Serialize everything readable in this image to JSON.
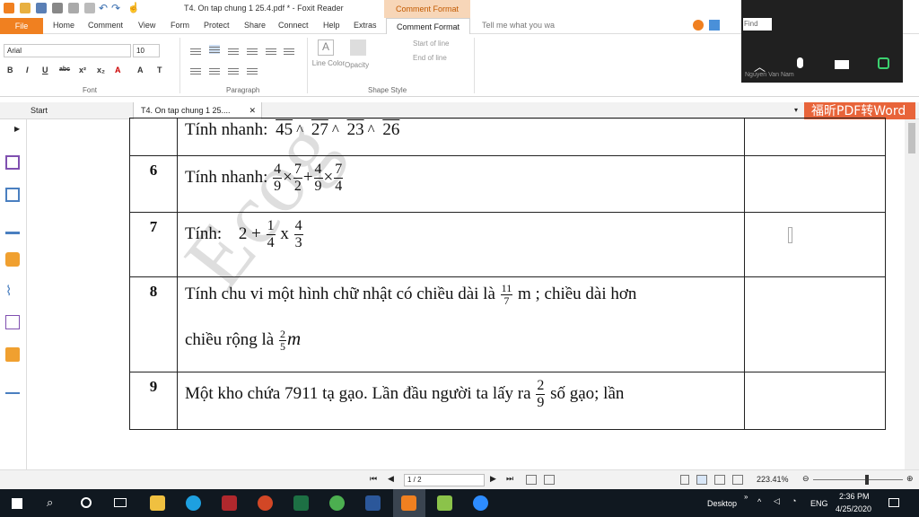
{
  "window": {
    "title": "T4. On tap chung 1 25.4.pdf * - Foxit Reader",
    "contextual_tab": "Comment Format"
  },
  "ribbon_tabs": [
    "File",
    "Home",
    "Comment",
    "View",
    "Form",
    "Protect",
    "Share",
    "Connect",
    "Help",
    "Extras",
    "Comment Format"
  ],
  "tell_me_placeholder": "Tell me what you wa",
  "ribbon": {
    "font_name": "Arial",
    "font_size": "10",
    "groups": {
      "font": "Font",
      "paragraph": "Paragraph",
      "shape_style": "Shape Style"
    },
    "line_color": "Line Color",
    "opacity": "Opacity",
    "start_of_line": "Start of line",
    "end_of_line": "End of line"
  },
  "doc_tabs": {
    "start": "Start",
    "file": "T4. On tap chung 1 25...."
  },
  "convert_button": "福昕PDF转Word",
  "zoom_overlay": {
    "find": "Find",
    "name": "Nguyen Van Nam"
  },
  "document": {
    "watermark": "Ecog",
    "rows": [
      {
        "num": "",
        "label": "Tính nhanh:",
        "ops": [
          "45",
          "27",
          "23",
          "26"
        ]
      },
      {
        "num": "6",
        "label": "Tính nhanh:",
        "expr": {
          "a": [
            "4",
            "9"
          ],
          "b": [
            "7",
            "2"
          ],
          "c": [
            "4",
            "9"
          ],
          "d": [
            "7",
            "4"
          ]
        }
      },
      {
        "num": "7",
        "label": "Tính:",
        "expr": {
          "lead": "2 +",
          "a": [
            "1",
            "4"
          ],
          "x": "x",
          "b": [
            "4",
            "3"
          ]
        }
      },
      {
        "num": "8",
        "line1_a": "Tính  chu vi một hình chữ nhật có chiều dài là",
        "frac1": [
          "11",
          "7"
        ],
        "line1_b": "m ; chiều dài hơn",
        "line2_a": "chiều rộng là",
        "frac2": [
          "2",
          "5"
        ],
        "line2_b": "m"
      },
      {
        "num": "9",
        "line_a": "Một kho chứa 7911 tạ gạo. Lần đầu người ta lấy ra",
        "frac": [
          "2",
          "9"
        ],
        "line_b": "số gạo; lần"
      }
    ]
  },
  "statusbar": {
    "page": "1 / 2",
    "zoom": "223.41%"
  },
  "taskbar": {
    "desktop": "Desktop",
    "lang": "ENG",
    "time": "2:36 PM",
    "date": "4/25/2020"
  }
}
